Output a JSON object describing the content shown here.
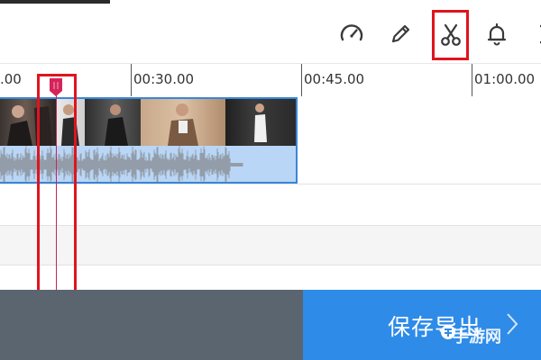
{
  "toolbar": {
    "tools": [
      {
        "name": "speed",
        "icon": "speedometer-icon"
      },
      {
        "name": "edit",
        "icon": "pencil-icon"
      },
      {
        "name": "cut",
        "icon": "scissors-icon",
        "highlighted": true
      },
      {
        "name": "notify",
        "icon": "bell-icon"
      },
      {
        "name": "more",
        "icon": "partial-icon"
      }
    ]
  },
  "timeline": {
    "ruler_labels": [
      ".00",
      "00:30.00",
      "00:45.00",
      "01:00.00"
    ]
  },
  "footer": {
    "export_label": "保存导出"
  },
  "watermark": {
    "text": "手游网"
  },
  "colors": {
    "accent": "#2e8be8",
    "highlight": "#e0141e",
    "playhead": "#c0265c",
    "clip_border": "#3a86d6"
  }
}
